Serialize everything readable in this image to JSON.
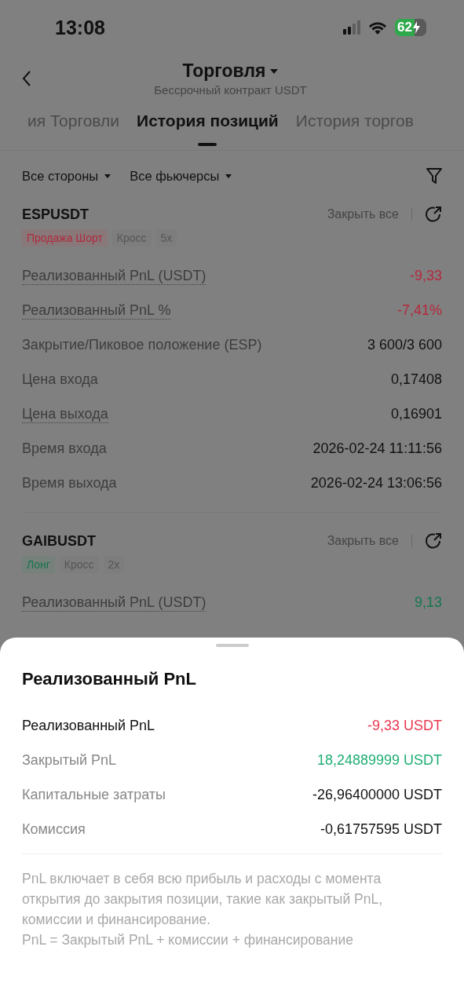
{
  "status_bar": {
    "time": "13:08",
    "battery": "62"
  },
  "header": {
    "title": "Торговля",
    "subtitle": "Бессрочный контракт USDT"
  },
  "tabs": [
    {
      "label": "ия Торговли",
      "selected": false
    },
    {
      "label": "История позиций",
      "selected": true
    },
    {
      "label": "История торгов",
      "selected": false
    }
  ],
  "filters": [
    "Все стороны",
    "Все фьючерсы"
  ],
  "positions": [
    {
      "symbol": "ESPUSDT",
      "close_all": "Закрыть все",
      "tags": [
        {
          "label": "Продажа Шорт",
          "color": "#b02a3c"
        },
        {
          "label": "Кросс",
          "color": "#555555"
        },
        {
          "label": "5x",
          "color": "#555555"
        }
      ],
      "rows": [
        {
          "label": "Реализованный PnL (USDT)",
          "value": "-9,33",
          "color": "#b5283c",
          "dotted": true
        },
        {
          "label": "Реализованный PnL %",
          "value": "-7,41%",
          "color": "#b5283c",
          "dotted": true
        },
        {
          "label": "Закрытие/Пиковое положение (ESP)",
          "value": "3 600/3 600",
          "color": "#111111",
          "dotted": false
        },
        {
          "label": "Цена входа",
          "value": "0,17408",
          "color": "#111111",
          "dotted": false
        },
        {
          "label": "Цена выхода",
          "value": "0,16901",
          "color": "#111111",
          "dotted": true
        },
        {
          "label": "Время входа",
          "value": "2026-02-24 11:11:56",
          "color": "#111111",
          "dotted": false
        },
        {
          "label": "Время выхода",
          "value": "2026-02-24 13:06:56",
          "color": "#111111",
          "dotted": false
        }
      ]
    },
    {
      "symbol": "GAIBUSDT",
      "close_all": "Закрыть все",
      "tags": [
        {
          "label": "Лонг",
          "color": "#16744c"
        },
        {
          "label": "Кросс",
          "color": "#555555"
        },
        {
          "label": "2x",
          "color": "#555555"
        }
      ],
      "rows": [
        {
          "label": "Реализованный PnL (USDT)",
          "value": "9,13",
          "color": "#13774f",
          "dotted": true
        }
      ]
    }
  ],
  "sheet": {
    "title": "Реализованный PnL",
    "rows": [
      {
        "label": "Реализованный PnL",
        "value": "-9,33 USDT",
        "color": "#e8394f",
        "emphasis": true
      },
      {
        "label": "Закрытый PnL",
        "value": "18,24889999 USDT",
        "color": "#1fae73",
        "emphasis": false
      },
      {
        "label": "Капитальные затраты",
        "value": "-26,96400000 USDT",
        "color": "#111111",
        "emphasis": false
      },
      {
        "label": "Комиссия",
        "value": "-0,61757595 USDT",
        "color": "#111111",
        "emphasis": false
      }
    ],
    "note": [
      "PnL включает в себя всю прибыль и расходы с момента открытия до закрытия позиции, такие как закрытый PnL, комиссии и финансирование.",
      "PnL = Закрытый PnL + комиссии + финансирование"
    ]
  }
}
